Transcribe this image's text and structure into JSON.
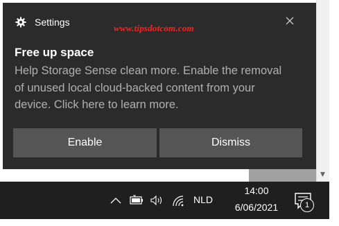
{
  "toast": {
    "app_name": "Settings",
    "watermark": "www.tipsdotcom.com",
    "title": "Free up space",
    "body": "Help Storage Sense clean more. Enable the removal of unused local cloud-backed content from your device. Click here to learn more.",
    "enable_label": "Enable",
    "dismiss_label": "Dismiss",
    "icons": {
      "app": "gear-icon",
      "close": "close-icon"
    }
  },
  "taskbar": {
    "language": "NLD",
    "time": "14:00",
    "date": "6/06/2021",
    "notification_count": "1",
    "icons": [
      "chevron-up-icon",
      "battery-icon",
      "volume-icon",
      "wifi-icon",
      "action-center-icon"
    ]
  },
  "colors": {
    "toast_bg": "#2b2b2b",
    "button_bg": "#555555",
    "taskbar_bg": "#1f1f1f",
    "watermark": "#ff2020",
    "body_text": "#b0b0b0"
  }
}
